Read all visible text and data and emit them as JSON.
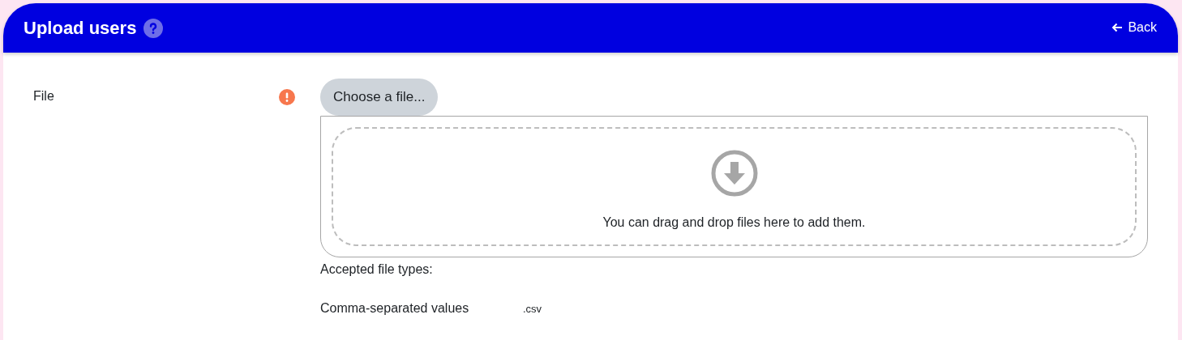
{
  "header": {
    "title": "Upload users",
    "back_link": "Back"
  },
  "field": {
    "label": "File",
    "required": true,
    "button": "Choose a file...",
    "drop_text": "You can drag and drop files here to add them.",
    "accepted_label": "Accepted file types:",
    "types": [
      {
        "name": "Comma-separated values",
        "extension": ".csv"
      }
    ]
  }
}
